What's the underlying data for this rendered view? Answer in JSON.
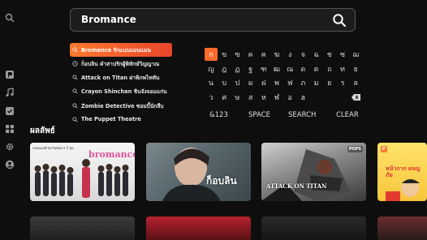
{
  "search": {
    "query": "Bromance"
  },
  "suggestions": [
    {
      "label": "Bromance รักแบบแมนแมน"
    },
    {
      "label": "ก็อบลิน คำสาปรักผู้พิทักษ์วิญญาณ"
    },
    {
      "label": "Attack on Titan ผ่าพิภพไททัน"
    },
    {
      "label": "Crayon Shinchan ชินจังจอมแก่น"
    },
    {
      "label": "Zombie Detective ซอมบี้นักสืบ"
    },
    {
      "label": "The Puppet Theatre"
    }
  ],
  "keyboard": {
    "rows": [
      [
        "ก",
        "ข",
        "ฃ",
        "ค",
        "ฅ",
        "ฆ",
        "ง",
        "จ",
        "ฉ",
        "ช",
        "ซ",
        "ฌ"
      ],
      [
        "ญ",
        "ฎ",
        "ฏ",
        "ฐ",
        "ฑ",
        "ฒ",
        "ณ",
        "ด",
        "ต",
        "ถ",
        "ท",
        "ธ"
      ],
      [
        "น",
        "บ",
        "ป",
        "ผ",
        "ฝ",
        "พ",
        "ฟ",
        "ภ",
        "ม",
        "ย",
        "ร",
        "ล"
      ],
      [
        "ว",
        "ศ",
        "ษ",
        "ส",
        "ห",
        "ฬ",
        "อ",
        "ฮ",
        "",
        "",
        "",
        ""
      ]
    ],
    "functions": [
      "&123",
      "SPACE",
      "SEARCH",
      "CLEAR"
    ]
  },
  "results": {
    "title": "ผลลัพธ์",
    "tiles": [
      {
        "label": "bromance",
        "caption": "บรอแมนซ์ ทุกวันอังคาร 1 ทุ่ม"
      },
      {
        "label": "ก็อบลิน"
      },
      {
        "label": "ATTACK ON TITAN",
        "badge": "POPS"
      },
      {
        "label": "หน้ากาก ผจญภัย",
        "badge": "P"
      }
    ]
  },
  "colors": {
    "accent": "#ff6a2a",
    "background": "#0e0e0e"
  },
  "icons": {
    "rail": [
      "search-icon",
      "p-logo-icon",
      "music-icon",
      "check-icon",
      "grid-icon",
      "settings-icon",
      "profile-icon"
    ],
    "suggestion": [
      "search-icon",
      "history-icon"
    ]
  }
}
